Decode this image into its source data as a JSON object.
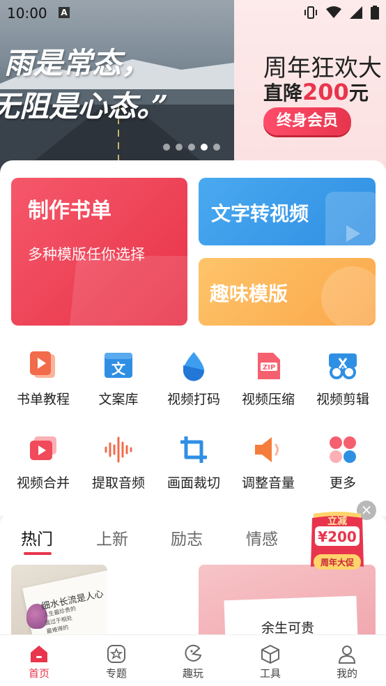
{
  "status_bar": {
    "time": "10:00",
    "notif": "A"
  },
  "banner": {
    "quote_line1": "雨是常态，",
    "quote_line2": "无阻是心态。”",
    "ad_title": "周年狂欢大",
    "ad_prefix": "直降",
    "ad_amount": "200",
    "ad_suffix": "元",
    "ad_button": "终身会员",
    "dot_count": 5,
    "active_dot": 4
  },
  "feature_cards": {
    "book_title": "制作书单",
    "book_subtitle": "多种模版任你选择",
    "text_video": "文字转视频",
    "fun_template": "趣味模版"
  },
  "tools": [
    {
      "label": "书单教程",
      "icon": "book-tutorial-icon"
    },
    {
      "label": "文案库",
      "icon": "copy-library-icon"
    },
    {
      "label": "视频打码",
      "icon": "video-mosaic-icon"
    },
    {
      "label": "视频压缩",
      "icon": "video-compress-icon"
    },
    {
      "label": "视频剪辑",
      "icon": "video-edit-icon"
    },
    {
      "label": "视频合并",
      "icon": "video-merge-icon"
    },
    {
      "label": "提取音频",
      "icon": "extract-audio-icon"
    },
    {
      "label": "画面裁切",
      "icon": "crop-icon"
    },
    {
      "label": "调整音量",
      "icon": "volume-icon"
    },
    {
      "label": "更多",
      "icon": "more-icon"
    }
  ],
  "tabs": [
    "热门",
    "上新",
    "励志",
    "情感"
  ],
  "active_tab": 0,
  "promo": {
    "line1": "立减",
    "line2": "¥200",
    "line3": "周年大促"
  },
  "thumbnails": {
    "first_title": "细水长流是人心",
    "first_lines": [
      "人生最珍贵的",
      "莫过于相处",
      "最难得的"
    ],
    "second_title": "余生可贵"
  },
  "bottom_nav": [
    "首页",
    "专题",
    "趣玩",
    "工具",
    "我的"
  ],
  "active_nav": 0,
  "colors": {
    "accent": "#e8354d",
    "blue": "#2f8fe3",
    "orange": "#fba74a"
  }
}
